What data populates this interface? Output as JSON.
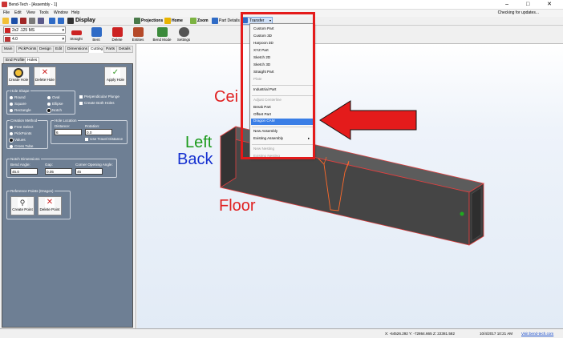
{
  "window": {
    "title": "Bend-Tech - [Assembly - 1]",
    "controls": [
      "–",
      "□",
      "✕"
    ]
  },
  "menu": {
    "items": [
      "File",
      "Edit",
      "View",
      "Tools",
      "Window",
      "Help"
    ],
    "update_text": "Checking for updates..."
  },
  "toolbar": {
    "display_label": "Display",
    "projections_label": "Projections",
    "home_label": "Home",
    "zoom_label": "Zoom",
    "part_details_label": "Part Details",
    "transfer_label": "Transfer"
  },
  "toolbar2": {
    "material_value": "2x2 .125 MS",
    "radius_value": "4.0",
    "buttons": [
      "Straight",
      "Bent",
      "Delete",
      "Entities",
      "Bend Mode",
      "Settings"
    ]
  },
  "left_tabs": [
    "Main",
    "PickPoints",
    "Design",
    "Edit",
    "Dimensions",
    "Cutting",
    "Parts",
    "Details"
  ],
  "sub_tabs": [
    "End Profiles",
    "Holes"
  ],
  "holes_panel": {
    "create_hole": "Create Hole",
    "delete_hole": "Delete Hole",
    "apply_hole": "Apply Hole",
    "hole_shape": {
      "label": "Hole Shape",
      "options": [
        "Round",
        "Square",
        "Rectangle",
        "Oval",
        "Ellipse",
        "Notch"
      ],
      "selected": "Notch"
    },
    "perpendicular_plunge": "Perpendicular Plunge",
    "create_both_holes": "Create Both Holes",
    "creation_method": {
      "label": "Creation Method",
      "options": [
        "Free Select",
        "PickPoints",
        "Values",
        "Cross Tube"
      ],
      "selected": "Values"
    },
    "hole_location": {
      "label": "Hole Location",
      "distance_label": "Distance:",
      "distance_value": "6",
      "rotation_label": "Rotation:",
      "rotation_value": "0.0",
      "use_travel_distance": "Use Travel Distance"
    },
    "notch_dimensions": {
      "label": "Notch Dimensions",
      "bend_angle_label": "Bend Angle:",
      "bend_angle_value": "45.0",
      "gap_label": "Gap:",
      "gap_value": "0.05",
      "corner_label": "Corner Opening Angle:",
      "corner_value": "45"
    },
    "reference_points": {
      "label": "Reference Points (Dragon)",
      "create_point": "Create Point",
      "delete_point": "Delete Point"
    }
  },
  "viewport": {
    "labels": {
      "ceiling": "Cei",
      "left": "Left",
      "back": "Back",
      "floor": "Floor"
    },
    "colors": {
      "ceiling": "#e02020",
      "left": "#1a9a1a",
      "back": "#1530d0",
      "floor": "#e02020"
    }
  },
  "transfer_menu": {
    "items": [
      {
        "label": "Custom Part",
        "disabled": false
      },
      {
        "label": "Custom 3D",
        "disabled": false
      },
      {
        "label": "Harpoon 3D",
        "disabled": false
      },
      {
        "label": "XYZ Part",
        "disabled": false
      },
      {
        "label": "Sketch 2D",
        "disabled": false
      },
      {
        "label": "Sketch 3D",
        "disabled": false
      },
      {
        "label": "Straight Part",
        "disabled": false
      },
      {
        "label": "Plate",
        "disabled": true
      },
      {
        "label": "Industrial Part",
        "disabled": false
      },
      {
        "label": "Adjust Centerline",
        "disabled": true
      },
      {
        "label": "Break Part",
        "disabled": false
      },
      {
        "label": "Offset Part",
        "disabled": false
      },
      {
        "label": "Dragon CAM",
        "disabled": false,
        "highlighted": true
      },
      {
        "label": "New Assembly",
        "disabled": false
      },
      {
        "label": "Existing Assembly",
        "disabled": false,
        "submenu": true
      },
      {
        "label": "New Nesting",
        "disabled": true
      },
      {
        "label": "Existing Nesting",
        "disabled": true
      }
    ]
  },
  "status": {
    "coords": "X: -64526.292  Y: -72864.665  Z: 22381.582",
    "datetime": "10/4/2017   10:21 AM",
    "link": "Visit bend-tech.com"
  }
}
